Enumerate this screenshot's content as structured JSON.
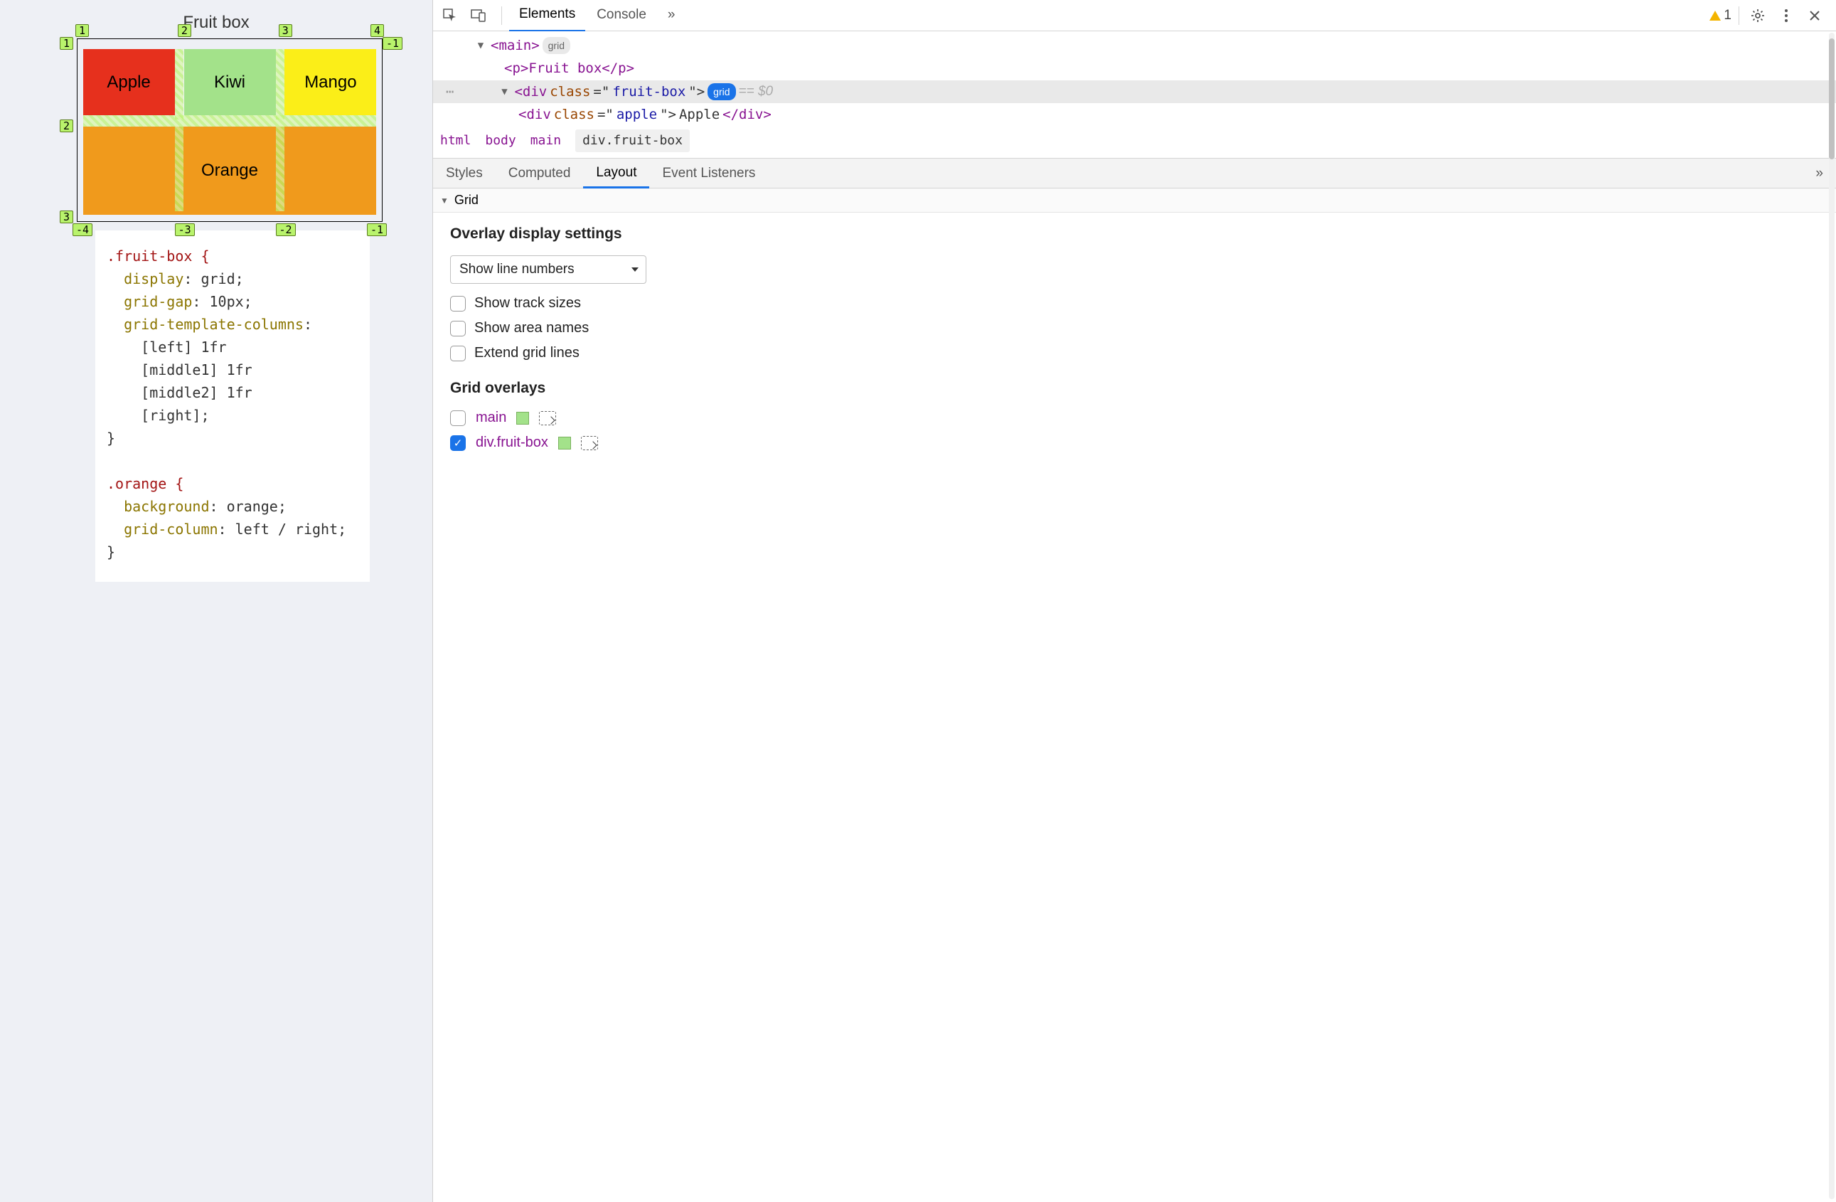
{
  "page": {
    "title": "Fruit box",
    "cells": {
      "apple": "Apple",
      "kiwi": "Kiwi",
      "mango": "Mango",
      "orange": "Orange"
    },
    "grid_labels": {
      "top": [
        "1",
        "2",
        "3",
        "4"
      ],
      "left": [
        "1",
        "2",
        "3"
      ],
      "right": [
        "-1"
      ],
      "bottom": [
        "-4",
        "-3",
        "-2",
        "-1"
      ]
    }
  },
  "code": {
    "sel1": ".fruit-box {",
    "p1": "  display",
    "v1": ": grid;",
    "p2": "  grid-gap",
    "v2": ": 10px;",
    "p3": "  grid-template-columns",
    "v3": ":",
    "l4": "    [left] 1fr",
    "l5": "    [middle1] 1fr",
    "l6": "    [middle2] 1fr",
    "l7": "    [right];",
    "close1": "}",
    "sel2": ".orange {",
    "p4": "  background",
    "v4": ": orange;",
    "p5": "  grid-column",
    "v5": ": left / right;",
    "close2": "}"
  },
  "devtools": {
    "tabs": {
      "elements": "Elements",
      "console": "Console",
      "more": "»",
      "warn_count": "1"
    },
    "dom": {
      "main_open": "<main>",
      "grid_chip": "grid",
      "p_line": "<p>Fruit box</p>",
      "div_open_a": "<div ",
      "div_class_n": "class",
      "div_class_eq": "=\"",
      "div_class_v": "fruit-box",
      "div_close_q": "\">",
      "eq0": " == $0",
      "child_open_a": "<div ",
      "child_class_v": "apple",
      "child_text": "Apple",
      "child_close": "</div>"
    },
    "breadcrumb": [
      "html",
      "body",
      "main",
      "div.fruit-box"
    ],
    "subtabs": {
      "styles": "Styles",
      "computed": "Computed",
      "layout": "Layout",
      "listeners": "Event Listeners",
      "more": "»"
    },
    "section_grid": "Grid",
    "overlay_settings": {
      "heading": "Overlay display settings",
      "select": "Show line numbers",
      "opts": [
        "Show track sizes",
        "Show area names",
        "Extend grid lines"
      ]
    },
    "grid_overlays": {
      "heading": "Grid overlays",
      "items": [
        {
          "label": "main",
          "checked": false
        },
        {
          "label": "div.fruit-box",
          "checked": true
        }
      ]
    }
  }
}
